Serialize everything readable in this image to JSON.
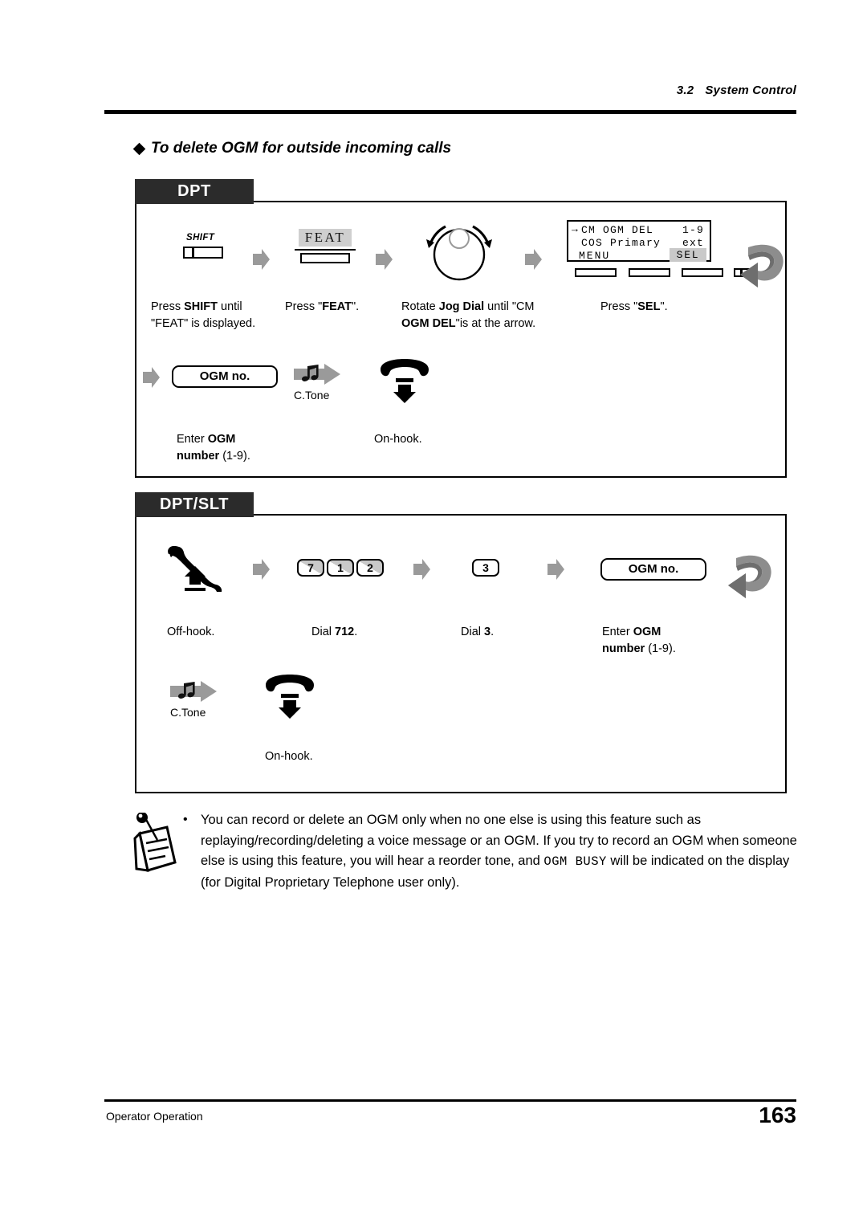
{
  "header": {
    "section_number": "3.2",
    "section_name": "System Control"
  },
  "page_title": "To delete OGM for outside incoming calls",
  "panels": [
    {
      "tab": "DPT",
      "steps": [
        {
          "icon": "shift-key-icon",
          "key_label": "SHIFT",
          "caption_line1_pre": "Press ",
          "caption_line1_bold": "SHIFT",
          "caption_line1_post": " until",
          "caption_line2": "\"FEAT\" is displayed."
        },
        {
          "icon": "feat-key-icon",
          "display_text": "FEAT",
          "caption_line1_pre": "Press \"",
          "caption_line1_bold": "FEAT",
          "caption_line1_post": "\"."
        },
        {
          "icon": "jog-dial-icon",
          "caption_line1_pre": "Rotate ",
          "caption_line1_bold": "Jog Dial",
          "caption_line1_post": " until \"CM",
          "caption_line2_bold": "OGM DEL",
          "caption_line2_post": "\"is at the arrow."
        },
        {
          "icon": "lcd-display-icon",
          "lcd": {
            "line1_left": "CM OGM DEL",
            "line1_right": "1-9",
            "line2_left": "COS Primary",
            "line2_right": "ext",
            "menu_label": "MENU",
            "sel_label": "SEL"
          },
          "caption_line1_pre": "Press \"",
          "caption_line1_bold": "SEL",
          "caption_line1_post": "\"."
        },
        {
          "icon": "ogm-number-pill-icon",
          "pill_label": "OGM no.",
          "caption_line1_pre": "Enter ",
          "caption_line1_bold": "OGM",
          "caption_line2_bold": "number",
          "caption_line2_post": " (1-9)."
        },
        {
          "icon": "confirmation-tone-icon",
          "tone_label": "C.Tone"
        },
        {
          "icon": "on-hook-handset-icon",
          "caption_line1": "On-hook."
        }
      ]
    },
    {
      "tab": "DPT/SLT",
      "steps": [
        {
          "icon": "off-hook-handset-icon",
          "caption_line1": "Off-hook."
        },
        {
          "icon": "dial-keys-icon",
          "keys": [
            "7",
            "1",
            "2"
          ],
          "caption_line1_pre": "Dial ",
          "caption_line1_bold": "712",
          "caption_line1_post": "."
        },
        {
          "icon": "dial-key-icon",
          "keys": [
            "3"
          ],
          "caption_line1_pre": "Dial ",
          "caption_line1_bold": "3",
          "caption_line1_post": "."
        },
        {
          "icon": "ogm-number-pill-icon",
          "pill_label": "OGM no.",
          "caption_line1_pre": "Enter ",
          "caption_line1_bold": "OGM",
          "caption_line2_bold": "number",
          "caption_line2_post": " (1-9)."
        },
        {
          "icon": "confirmation-tone-icon",
          "tone_label": "C.Tone"
        },
        {
          "icon": "on-hook-handset-icon",
          "caption_line1": "On-hook."
        }
      ]
    }
  ],
  "note": {
    "bullet": "•",
    "text_part1": "You can record or delete an OGM only when no one else is using this feature such as replaying/recording/deleting a voice message or an OGM. If you try to record an OGM when someone else is using this feature, you will hear a reorder tone, and ",
    "text_mono": "OGM BUSY",
    "text_part2": " will be indicated on the display (for Digital Proprietary Telephone user only)."
  },
  "footer": {
    "left": "Operator Operation",
    "page_number": "163"
  }
}
